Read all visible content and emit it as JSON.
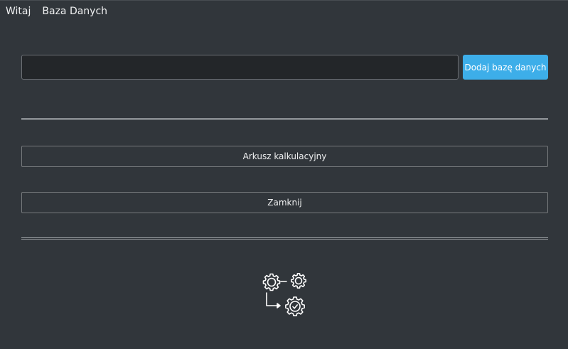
{
  "menu": {
    "items": [
      {
        "label": "Witaj"
      },
      {
        "label": "Baza Danych"
      }
    ]
  },
  "database": {
    "input_value": "",
    "add_button_label": "Dodaj bazę danych"
  },
  "actions": {
    "spreadsheet_label": "Arkusz kalkulacyjny",
    "close_label": "Zamknij"
  },
  "logo": {
    "icon": "gears-workflow-icon",
    "color": "#ffffff"
  },
  "colors": {
    "background": "#31363b",
    "input_background": "#232629",
    "accent": "#3daee9"
  }
}
